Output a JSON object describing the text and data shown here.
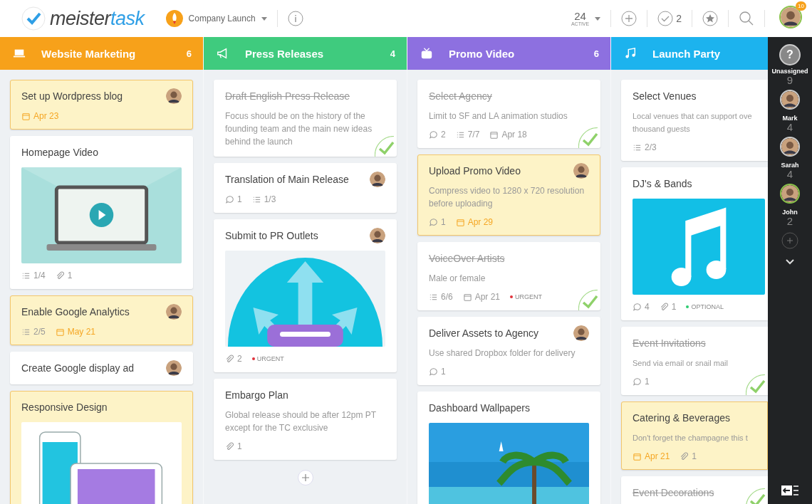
{
  "header": {
    "logo": "meister**task**",
    "project": "Company Launch",
    "active_count": "24",
    "active_label": "ACTIVE",
    "completed_count": "2",
    "notification_count": "10"
  },
  "columns": [
    {
      "name": "Website Marketing",
      "count": "6",
      "color": "#f7a11a",
      "add_button": false,
      "cards": [
        {
          "kind": "plain",
          "title": "Set up Wordpress blog",
          "highlighted": true,
          "done": false,
          "assigned": true,
          "meta": [
            {
              "kind": "date",
              "text": "Apr 23"
            }
          ]
        },
        {
          "kind": "video",
          "title": "Homepage Video",
          "highlighted": false,
          "done": false,
          "assigned": false,
          "meta": [
            {
              "kind": "checklist",
              "text": "1/4"
            },
            {
              "kind": "attachment",
              "text": "1"
            }
          ]
        },
        {
          "kind": "plain",
          "title": "Enable Google Analytics",
          "highlighted": true,
          "done": false,
          "assigned": true,
          "meta": [
            {
              "kind": "checklist",
              "text": "2/5"
            },
            {
              "kind": "date",
              "text": "May 21"
            }
          ]
        },
        {
          "kind": "plain",
          "title": "Create Google display ad",
          "highlighted": false,
          "done": false,
          "assigned": true
        },
        {
          "kind": "devices",
          "title": "Responsive Design",
          "highlighted": true,
          "done": false,
          "assigned": false
        }
      ]
    },
    {
      "name": "Press Releases",
      "count": "4",
      "color": "#3fcb7e",
      "add_button": true,
      "cards": [
        {
          "kind": "plain",
          "title": "Draft English Press Release",
          "highlighted": false,
          "done": true,
          "assigned": false,
          "description": "Focus should be on the history of the founding team and the main new ideas behind the launch"
        },
        {
          "kind": "plain",
          "title": "Translation of Main Release",
          "highlighted": false,
          "done": false,
          "assigned": true,
          "meta": [
            {
              "kind": "comment",
              "text": "1"
            },
            {
              "kind": "checklist",
              "text": "1/3"
            }
          ]
        },
        {
          "kind": "share",
          "title": "Submit to PR Outlets",
          "highlighted": false,
          "done": false,
          "assigned": true,
          "meta": [
            {
              "kind": "attachment",
              "text": "2"
            },
            {
              "kind": "tag",
              "text": "URGENT",
              "color": "#e0323c"
            }
          ]
        },
        {
          "kind": "plain",
          "title": "Embargo Plan",
          "highlighted": false,
          "done": false,
          "assigned": false,
          "description": "Global release should be after 12pm PT except for the TC exclusive",
          "meta": [
            {
              "kind": "attachment",
              "text": "1"
            }
          ]
        }
      ]
    },
    {
      "name": "Promo Video",
      "count": "6",
      "color": "#8d70e0",
      "add_button": false,
      "cards": [
        {
          "kind": "plain",
          "title": "Select Agency",
          "highlighted": false,
          "done": true,
          "assigned": false,
          "description": "Limit to SF and LA animation studios",
          "meta": [
            {
              "kind": "comment",
              "text": "2"
            },
            {
              "kind": "checklist",
              "text": "7/7"
            },
            {
              "kind": "date",
              "text": "Apr 18"
            }
          ]
        },
        {
          "kind": "plain",
          "title": "Upload Promo Video",
          "highlighted": true,
          "done": false,
          "assigned": true,
          "description": "Compress video to 1280 x 720 resolution before uploading",
          "meta": [
            {
              "kind": "comment",
              "text": "1"
            },
            {
              "kind": "date",
              "text": "Apr 29"
            }
          ]
        },
        {
          "kind": "plain",
          "title": "VoiceOver Artists",
          "highlighted": false,
          "done": true,
          "assigned": false,
          "description": "Male or female",
          "meta": [
            {
              "kind": "checklist",
              "text": "6/6"
            },
            {
              "kind": "date",
              "text": "Apr 21"
            },
            {
              "kind": "tag",
              "text": "URGENT",
              "color": "#e0323c"
            }
          ]
        },
        {
          "kind": "plain",
          "title": "Deliver Assets to Agency",
          "highlighted": false,
          "done": false,
          "assigned": true,
          "description": "Use shared Dropbox folder for delivery",
          "meta": [
            {
              "kind": "comment",
              "text": "1"
            }
          ]
        },
        {
          "kind": "beach",
          "title": "Dashboard Wallpapers",
          "highlighted": false,
          "done": false,
          "assigned": false
        }
      ]
    },
    {
      "name": "Launch Party",
      "color": "#1cb3ee",
      "add_button": false,
      "cards": [
        {
          "kind": "plain",
          "title": "Select Venues",
          "highlighted": false,
          "done": false,
          "assigned": false,
          "description": "Local venues that can support ove\nthousand guests",
          "meta": [
            {
              "kind": "checklist",
              "text": "2/3"
            }
          ]
        },
        {
          "kind": "music",
          "title": "DJ's & Bands",
          "highlighted": false,
          "done": false,
          "assigned": false,
          "meta": [
            {
              "kind": "comment",
              "text": "4"
            },
            {
              "kind": "attachment",
              "text": "1"
            },
            {
              "kind": "tag",
              "text": "OPTIONAL",
              "color": "#2ecc71"
            }
          ]
        },
        {
          "kind": "plain",
          "title": "Event Invitations",
          "highlighted": false,
          "done": true,
          "assigned": false,
          "description": "Send via email or snail mail",
          "meta": [
            {
              "kind": "comment",
              "text": "1"
            }
          ]
        },
        {
          "kind": "plain",
          "title": "Catering & Beverages",
          "highlighted": true,
          "done": false,
          "assigned": false,
          "description": "Don't forget the champagne this t",
          "meta": [
            {
              "kind": "date",
              "text": "Apr 21"
            },
            {
              "kind": "attachment",
              "text": "1"
            }
          ]
        },
        {
          "kind": "plain",
          "title": "Event Decorations",
          "highlighted": false,
          "done": true,
          "assigned": false
        }
      ]
    }
  ],
  "sidebar": {
    "people": [
      {
        "kind": "unassigned",
        "glyph": "?",
        "name": "Unassigned",
        "count": "9",
        "selected": false
      },
      {
        "kind": "person",
        "name": "Mark",
        "count": "4",
        "selected": false
      },
      {
        "kind": "person",
        "name": "Sarah",
        "count": "4",
        "selected": false
      },
      {
        "kind": "person",
        "name": "John",
        "count": "2",
        "selected": true
      }
    ]
  }
}
